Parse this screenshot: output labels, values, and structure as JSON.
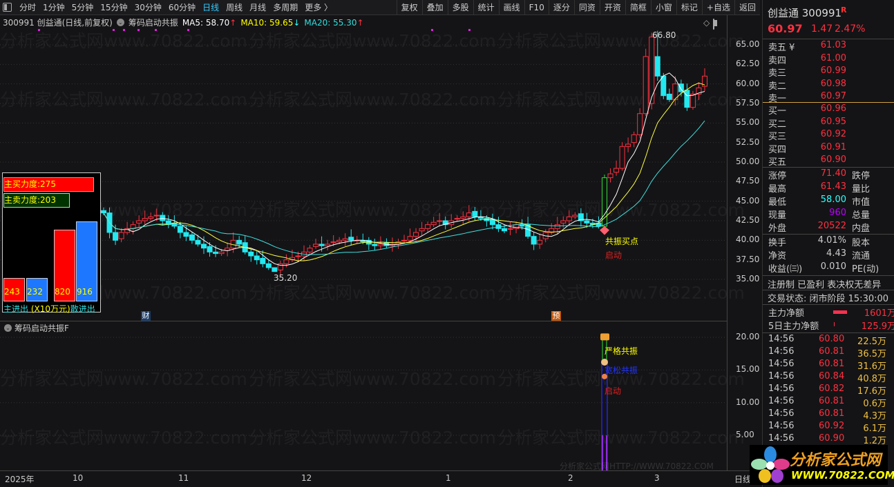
{
  "toolbar": {
    "left": [
      "分时",
      "1分钟",
      "5分钟",
      "15分钟",
      "30分钟",
      "60分钟",
      "日线",
      "周线",
      "月线",
      "多周期",
      "更多 〉"
    ],
    "active": "日线",
    "right": [
      "复权",
      "叠加",
      "多股",
      "统计",
      "画线",
      "F10",
      "逐分",
      "同资",
      "开资",
      "简框",
      "小窗",
      "标记",
      "+自选",
      "返回"
    ]
  },
  "info": {
    "title": "300991 创益通(日线,前复权)",
    "indicator": "筹码启动共振",
    "ma5": "MA5: 58.70",
    "ma10": "MA10: 59.65",
    "ma20": "MA20: 55.30",
    "ma5_arrow": "↑",
    "ma10_arrow": "↓",
    "ma20_arrow": "↑"
  },
  "watermark": "分析家公式网www.70822.com",
  "watermark2": "分析家公式网HTTP://WWW.70822.COM",
  "axis": {
    "main": [
      "65.00",
      "62.50",
      "60.00",
      "57.50",
      "55.00",
      "52.50",
      "50.00",
      "47.50",
      "45.00",
      "42.50",
      "40.00",
      "37.50",
      "35.00"
    ],
    "lower": [
      "20.00",
      "15.00",
      "10.00",
      "5.00"
    ],
    "dates": [
      "2025年",
      "10",
      "11",
      "12",
      "1",
      "2",
      "3",
      "日线"
    ]
  },
  "chart_data": {
    "type": "candlestick",
    "title": "300991 创益通 日线",
    "ylim": [
      35,
      65
    ],
    "high_label": "66.80",
    "low_label": "35.20",
    "closes": [
      43.5,
      41,
      40,
      41,
      41.5,
      42,
      42.5,
      42.8,
      43,
      43.2,
      42.5,
      42,
      41.8,
      41,
      40.5,
      40,
      39.5,
      39,
      38.5,
      38.3,
      38.5,
      39,
      40,
      39.5,
      38.5,
      38,
      37.5,
      37,
      36.5,
      36,
      37,
      37.5,
      37.8,
      38,
      38.5,
      39,
      39.5,
      39.3,
      39.5,
      39.8,
      40,
      40.2,
      40,
      40,
      39.8,
      39.5,
      39.3,
      39.5,
      39.3,
      39.5,
      39.8,
      40,
      40.5,
      41,
      41.5,
      42,
      42.3,
      42.5,
      42,
      42.5,
      42.8,
      43,
      43.5,
      43,
      42.8,
      42.5,
      42,
      41.5,
      41.2,
      41.5,
      42,
      41.8,
      40.5,
      39.5,
      40,
      41,
      41.5,
      42,
      42.5,
      43,
      43.2,
      42.5,
      42.2,
      42,
      41.8,
      48,
      48.5,
      49.2,
      52,
      52.3,
      53.5,
      56.2,
      63.5,
      66,
      61,
      58.5,
      58,
      60,
      59,
      57,
      58.7,
      59.5,
      61
    ],
    "ma_periods": [
      5,
      10,
      20
    ],
    "lower": {
      "title": "筹码启动共振F",
      "ylim": [
        0,
        21
      ],
      "signals": [
        "严格共振",
        "宽松共振",
        "启动"
      ]
    },
    "main_signals": [
      "共振买点",
      "启动"
    ]
  },
  "markers": {
    "fin": "财",
    "pre": "预"
  },
  "box": {
    "buy": "主买力度:275",
    "sell": "主卖力度:203",
    "v1": "243",
    "v2": "232",
    "v3": "820",
    "v4": "916",
    "bars": [
      243,
      232,
      820,
      916
    ],
    "legend1": "主进出",
    "legend2": "(X10万元)",
    "legend3": "散进出"
  },
  "side": {
    "name": "创益通 300991",
    "badge": "R",
    "price": "60.97",
    "chg": "1.47",
    "pct": "2.47%",
    "asks": [
      [
        "卖五 ¥",
        "61.03"
      ],
      [
        "卖四",
        "61.00"
      ],
      [
        "卖三",
        "60.99"
      ],
      [
        "卖二",
        "60.98"
      ],
      [
        "卖一",
        "60.97"
      ]
    ],
    "bids": [
      [
        "买一",
        "60.96"
      ],
      [
        "买二",
        "60.95"
      ],
      [
        "买三",
        "60.92"
      ],
      [
        "买四",
        "60.91"
      ],
      [
        "买五",
        "60.90"
      ]
    ],
    "stats": [
      [
        "涨停",
        "71.40",
        "跌停"
      ],
      [
        "最高",
        "61.43",
        "量比"
      ],
      [
        "最低",
        "58.00",
        "市值"
      ],
      [
        "现量",
        "960",
        "总量"
      ],
      [
        "外盘",
        "20522",
        "内盘"
      ]
    ],
    "stats2": [
      [
        "换手",
        "4.01%",
        "股本"
      ],
      [
        "净资",
        "4.43",
        "流通"
      ],
      [
        "收益(㈢)",
        "0.010",
        "PE(动)"
      ]
    ],
    "tags": "注册制 已盈利 表决权无差异",
    "status": "交易状态: 闭市阶段 15:30:00",
    "flow": [
      [
        "主力净额",
        "1601万"
      ],
      [
        "5日主力净额",
        "125.9万"
      ]
    ],
    "trades": [
      [
        "14:56",
        "60.80",
        "22.5万"
      ],
      [
        "14:56",
        "60.81",
        "36.5万"
      ],
      [
        "14:56",
        "60.81",
        "31.6万"
      ],
      [
        "14:56",
        "60.84",
        "40.8万"
      ],
      [
        "14:56",
        "60.82",
        "17.6万"
      ],
      [
        "14:56",
        "60.81",
        "0.6万"
      ],
      [
        "14:56",
        "60.81",
        "4.3万"
      ],
      [
        "14:56",
        "60.92",
        "6.1万"
      ],
      [
        "14:56",
        "60.90",
        "1.2万"
      ]
    ]
  },
  "logo": {
    "cn": "分析家公式网",
    "url": "WWW.70822.COM"
  },
  "colors": {
    "up": "#ff3040",
    "down": "#22e8f0",
    "ma5": "#ffffff",
    "ma10": "#ffff40",
    "ma20": "#40e0e0"
  }
}
